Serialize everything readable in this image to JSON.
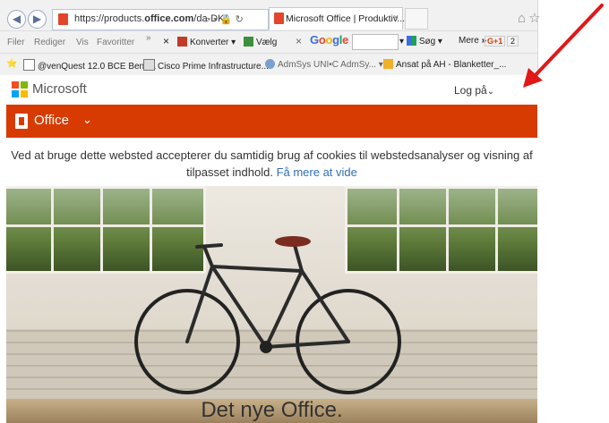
{
  "browser": {
    "url_prefix": "https://products.",
    "url_bold": "office.com",
    "url_suffix": "/da-DK/",
    "url_controls": "⌕ ▾ 🔒 ↻",
    "tab_title": "Microsoft Office | Produktiv...",
    "tab_close": "×",
    "menu": [
      "Filer",
      "Rediger",
      "Vis",
      "Favoritter"
    ],
    "menu_more": "»",
    "toolbar": {
      "close_x": "×",
      "convert": "Konverter",
      "select": "Vælg",
      "google_close": "×",
      "search_btn": "Søg",
      "more": "Mere",
      "more_arrows": "»",
      "gplus": "G+1",
      "gplus_count": "2"
    },
    "favorites": [
      "@venQuest 12.0 BCE Benc...",
      "Cisco Prime Infrastructure...",
      "AdmSys UNI•C AdmSy...",
      "Ansat på AH - Blanketter_..."
    ]
  },
  "header": {
    "brand": "Microsoft",
    "login": "Log på",
    "login_chevron": "⌄",
    "product": "Office",
    "product_chevron": "⌄"
  },
  "cookie": {
    "text": "Ved at bruge dette websted accepterer du samtidig brug af cookies til webstedsanalyser og visning af tilpasset indhold.",
    "link": "Få mere at vide"
  },
  "hero": {
    "title": "Det nye Office."
  },
  "colors": {
    "office_orange": "#d83b01",
    "annotation_red": "#e01818",
    "link_blue": "#2f6fba"
  }
}
